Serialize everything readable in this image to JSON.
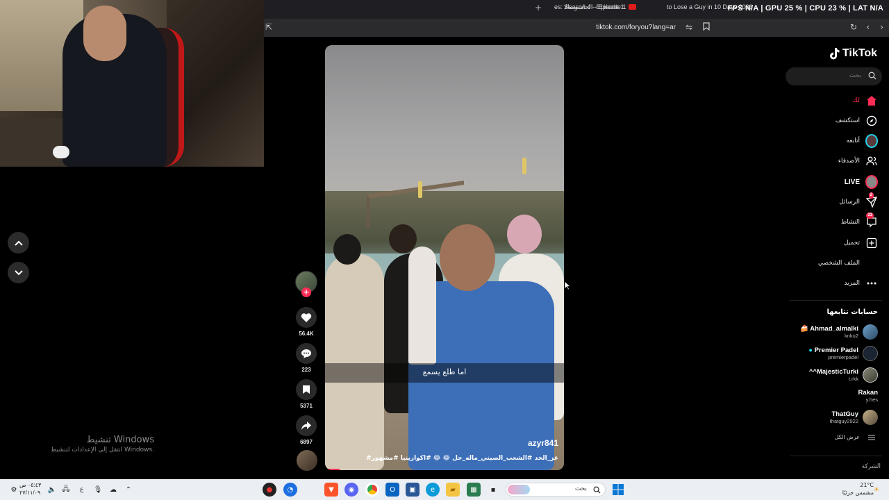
{
  "browser": {
    "tabs": [
      {
        "label": "to Lose a Guy in 10 Days 2003",
        "has_youtube_icon": false
      },
      {
        "label": "الجاسوسالا - Episode 1",
        "has_youtube_icon": true
      },
      {
        "label": "es: Season 4 - Episode 1",
        "has_youtube_icon": false
      }
    ],
    "new_tab_symbol": "+",
    "url": "tiktok.com/foryou?lang=ar"
  },
  "overlay_stats": "FPS N/A   |   GPU 25 %   |   CPU 23 %   |   LAT N/A",
  "windows_activation": {
    "title": "تنشيط Windows",
    "subtitle": "انتقل إلى الإعدادات لتنشيط Windows."
  },
  "video": {
    "subtitle": "اما طلع يسمع",
    "author": "azyr841",
    "caption": "#عز_الخد #الشعب_الصيني_ماله_حل 😂 😂 #اكوارينيا #مشهور",
    "progress": 0.06
  },
  "actions": {
    "follow_symbol": "+",
    "likes": "56.4K",
    "comments": "223",
    "saves": "5371",
    "shares": "6897"
  },
  "sidebar": {
    "logo": "TikTok",
    "search_placeholder": "بحث",
    "nav": [
      {
        "label": "لك",
        "icon": "home-icon",
        "active": true
      },
      {
        "label": "استكشف",
        "icon": "compass-icon"
      },
      {
        "label": "أتابعه",
        "icon": "following-avatar-icon"
      },
      {
        "label": "الأصدقاء",
        "icon": "friends-icon"
      },
      {
        "label": "LIVE",
        "icon": "live-icon"
      },
      {
        "label": "الرسائل",
        "icon": "messages-icon",
        "badge": "2"
      },
      {
        "label": "النشاط",
        "icon": "activity-icon",
        "badge": "23"
      },
      {
        "label": "تحميل",
        "icon": "upload-icon"
      },
      {
        "label": "الملف الشخصي",
        "icon": "profile-icon"
      },
      {
        "label": "المزيد",
        "icon": "more-icon"
      }
    ],
    "following_title": "حسابات تتابعها",
    "accounts": [
      {
        "name": "Ahmad_almalki",
        "handle": "knku2",
        "prefix": "🍰"
      },
      {
        "name": "Premier Padel",
        "handle": "premierpadel",
        "prefix": "●"
      },
      {
        "name": "^^MajesticTurki",
        "handle": "t.rkk",
        "prefix": ""
      },
      {
        "name": "Rakan",
        "handle": "y.hes",
        "prefix": ""
      },
      {
        "name": "ThatGuy",
        "handle": "thatguy2922",
        "prefix": ""
      }
    ],
    "see_all": "عرض الكل",
    "company": "الشركة"
  },
  "taskbar": {
    "search_placeholder": "بحث",
    "time": "٠٥:٤٣ ص",
    "date": "٢٧/١١/٠٩",
    "language": "ع",
    "weather_temp": "21°C",
    "weather_desc": "مشمس جزئيًا"
  },
  "colors": {
    "accent": "#fe2c55",
    "live_badge": "#fe2c55",
    "premier_badge": "#20d5ec"
  }
}
